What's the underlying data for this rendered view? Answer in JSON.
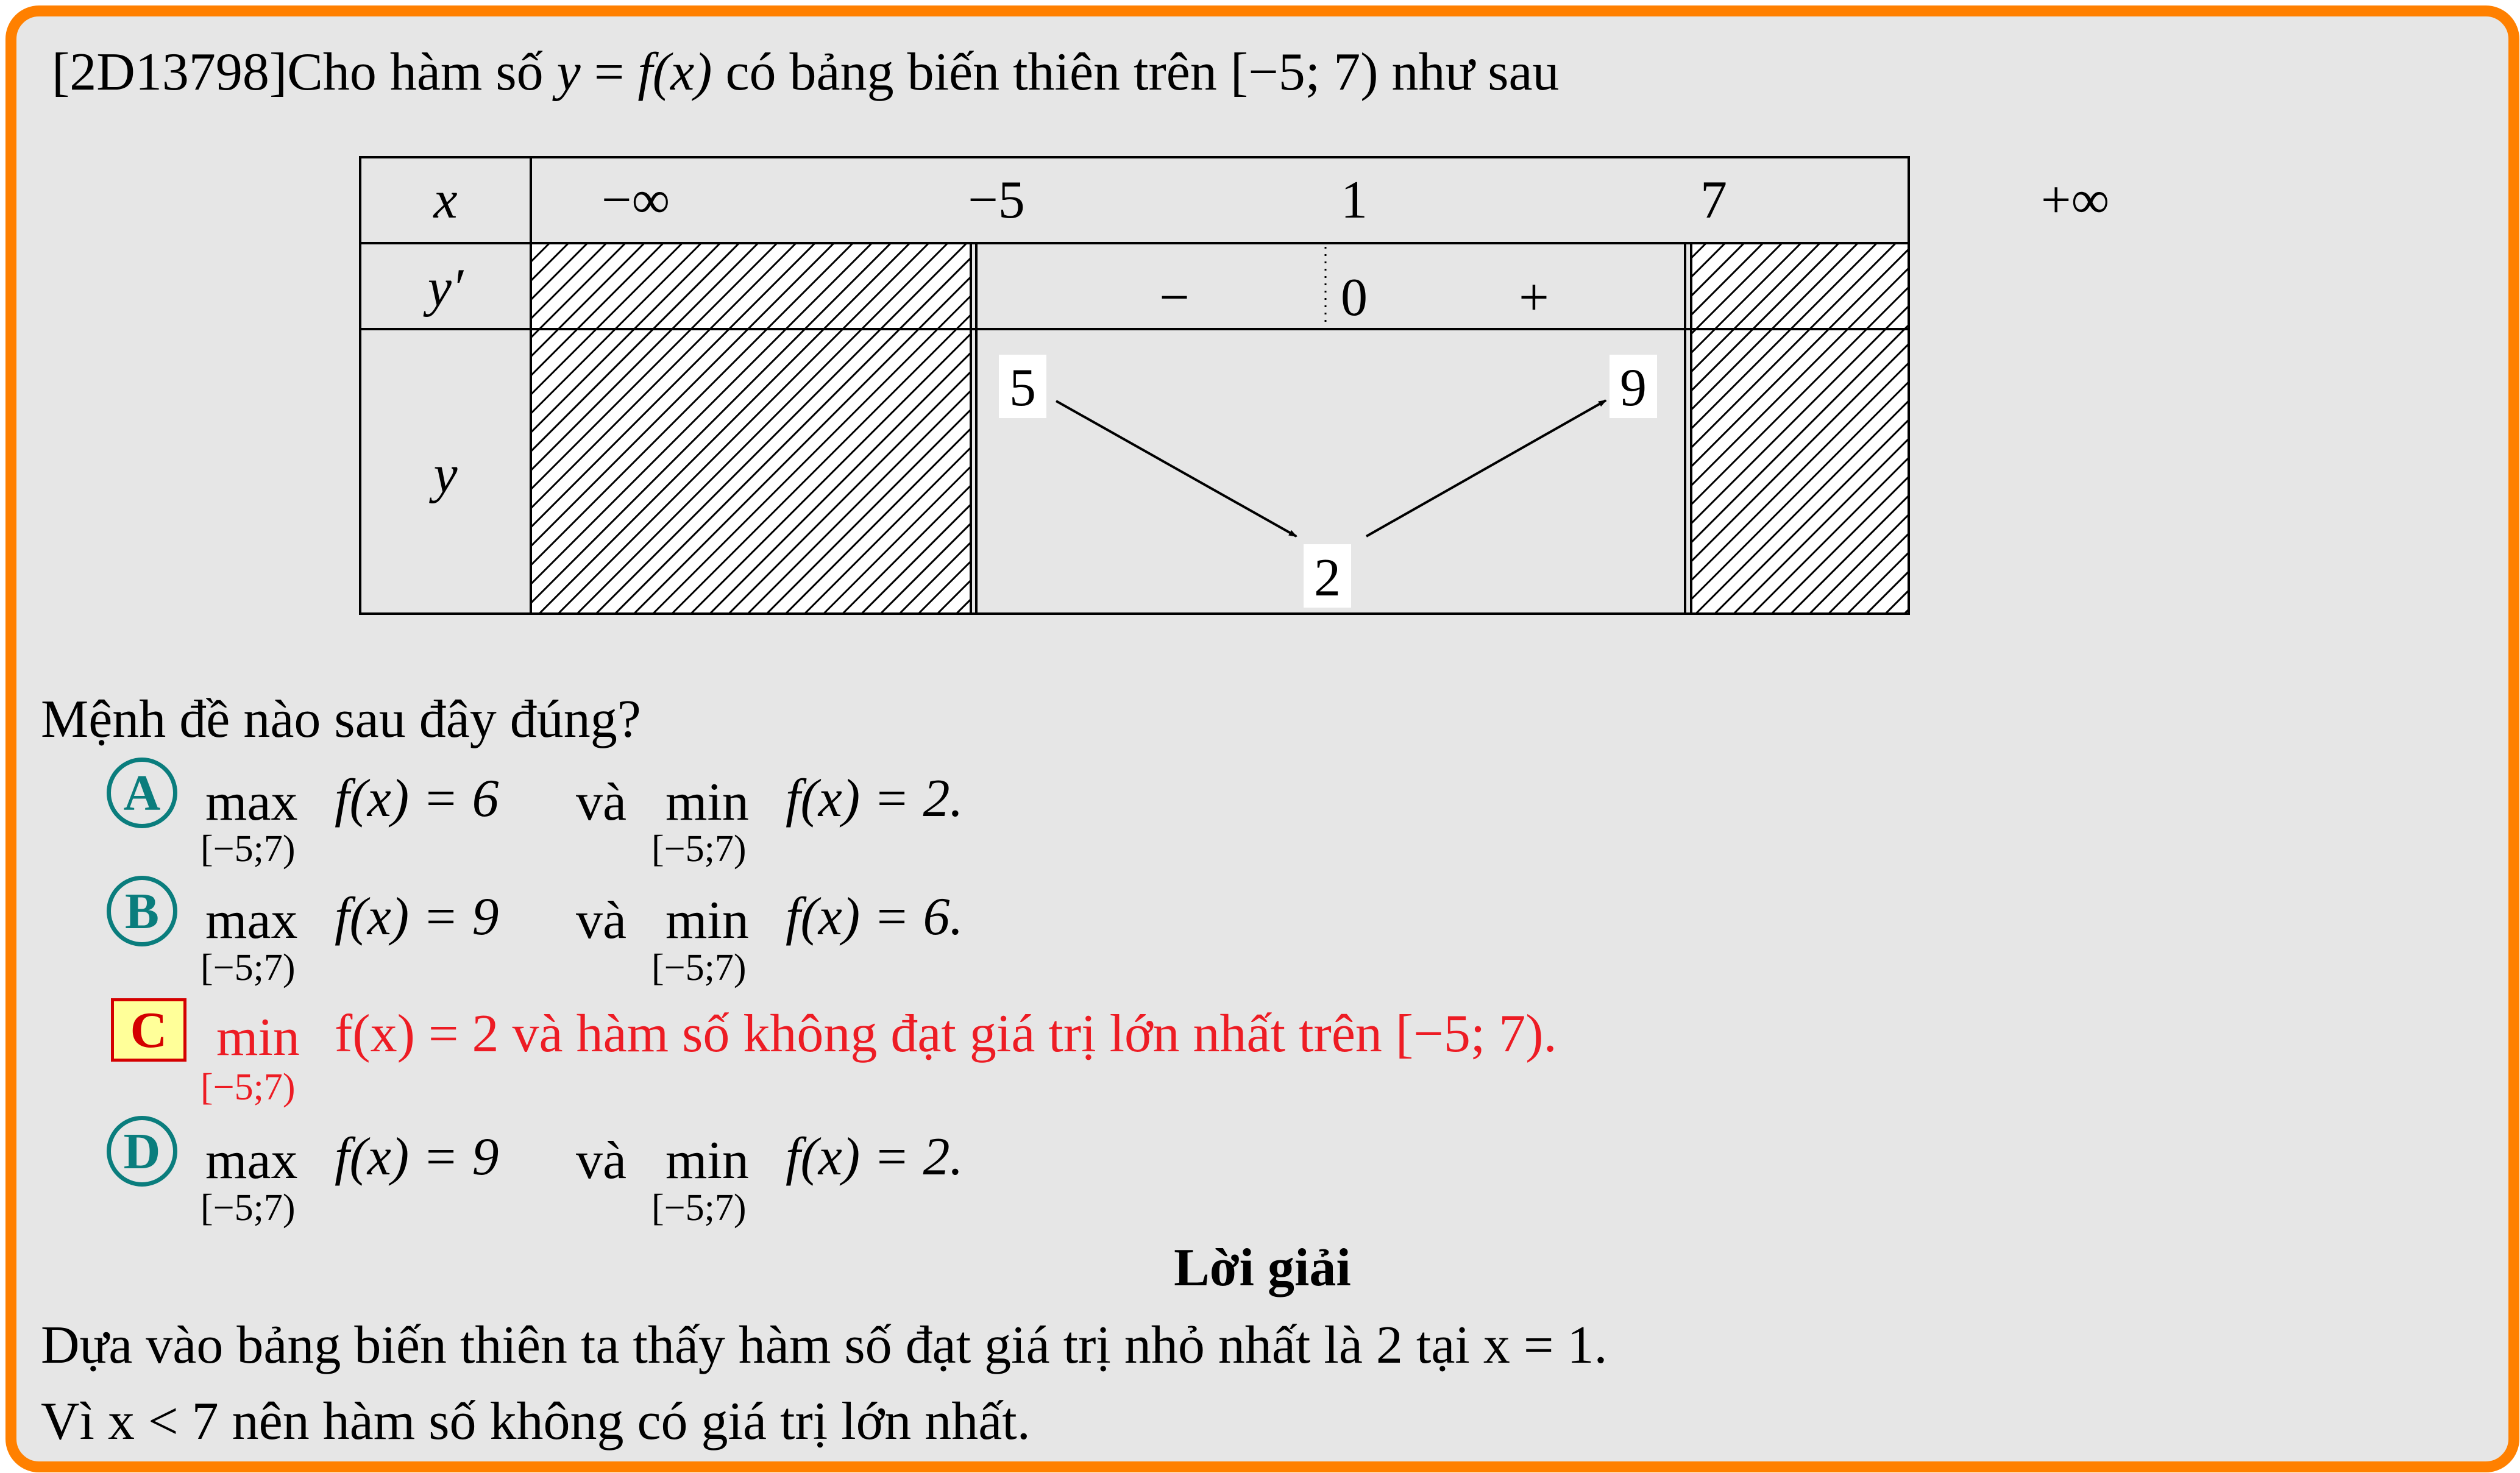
{
  "question": {
    "code": "[2D13798]",
    "stem_pre": "Cho hàm số",
    "stem_y": "y",
    "stem_eq": " = ",
    "stem_fx": "f(x)",
    "stem_post": "có bảng biến thiên trên",
    "stem_interval": "[−5; 7)",
    "stem_end": "như sau"
  },
  "table": {
    "row_labels": {
      "x": "x",
      "dy": "y′",
      "y": "y"
    },
    "x_values": [
      "−∞",
      "−5",
      "1",
      "7",
      "+∞"
    ],
    "derivative": {
      "minus": "−",
      "zero": "0",
      "plus": "+"
    },
    "y_values": {
      "left": "5",
      "bottom": "2",
      "right": "9"
    }
  },
  "prompt": "Mệnh đề nào sau đây đúng?",
  "options": [
    {
      "letter": "A",
      "op1": "max",
      "sub1": "[−5;7)",
      "eq1": "f(x) = 6",
      "conj": "và",
      "op2": "min",
      "sub2": "[−5;7)",
      "eq2": "f(x) = 2."
    },
    {
      "letter": "B",
      "op1": "max",
      "sub1": "[−5;7)",
      "eq1": "f(x) = 9",
      "conj": "và",
      "op2": "min",
      "sub2": "[−5;7)",
      "eq2": "f(x) = 6."
    },
    {
      "letter": "C",
      "op1": "min",
      "sub1": "[−5;7)",
      "text": "f(x) = 2 và hàm số không đạt giá trị lớn nhất trên [−5; 7).",
      "correct": true
    },
    {
      "letter": "D",
      "op1": "max",
      "sub1": "[−5;7)",
      "eq1": "f(x) = 9",
      "conj": "và",
      "op2": "min",
      "sub2": "[−5;7)",
      "eq2": "f(x) = 2."
    }
  ],
  "solution": {
    "heading": "Lời giải",
    "line1": "Dựa vào bảng biến thiên ta thấy hàm số đạt giá trị nhỏ nhất là 2 tại x = 1.",
    "line2": "Vì x < 7 nên hàm số không có giá trị lớn nhất."
  },
  "colors": {
    "frame": "#ff8000",
    "background": "#e6e6e6",
    "answer_red": "#ed1c24",
    "circle_teal": "#0a7d7d",
    "answer_box": "#ffff99"
  }
}
